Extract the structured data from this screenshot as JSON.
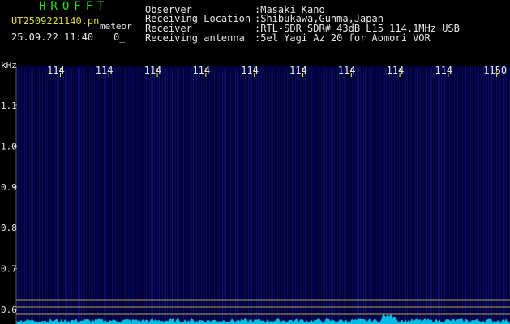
{
  "header": {
    "title": "HROFFT",
    "file_name": "UT2509221140.pn",
    "meteor_label": "meteor",
    "timestamp": "25.09.22 11:40",
    "meteor_count": "0_"
  },
  "info": [
    {
      "label": "Observer",
      "value": ":Masaki Kano"
    },
    {
      "label": "Receiving Location",
      "value": ":Shibukawa,Gunma,Japan"
    },
    {
      "label": "Receiver",
      "value": ":RTL-SDR SDR# 43dB L15 114.1MHz USB"
    },
    {
      "label": "Receiving antenna",
      "value": ":5el Yagi Az 20 for Aomori VOR"
    }
  ],
  "waterfall": {
    "unit_label": "kHz",
    "x_ticks": [
      "114",
      "114",
      "114",
      "114",
      "114",
      "114",
      "114",
      "114",
      "114",
      "1150"
    ],
    "y_ticks": [
      "1.1",
      "1.0",
      "0.9",
      "0.8",
      "0.7",
      "0.6"
    ],
    "colors": {
      "background": "#00003c",
      "tick": "#ffff00",
      "line": "#b4a064",
      "signal": "#00dcff"
    }
  }
}
